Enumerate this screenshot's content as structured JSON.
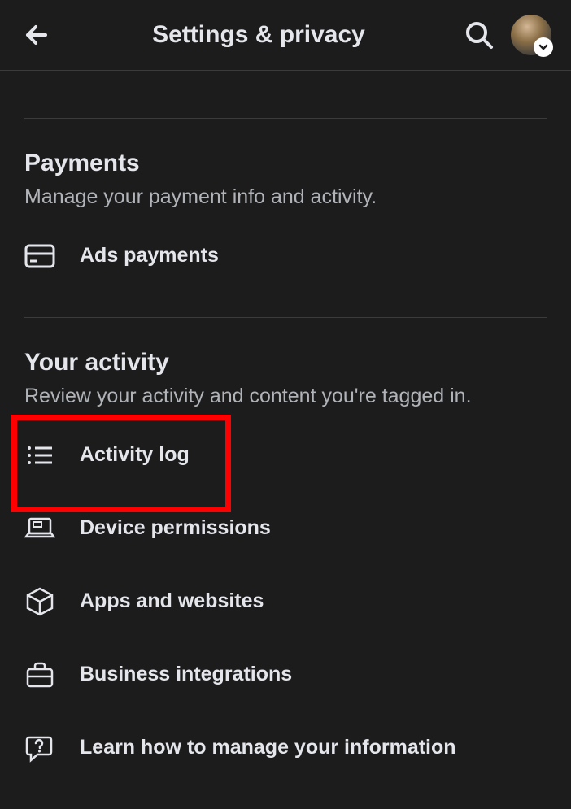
{
  "header": {
    "title": "Settings & privacy"
  },
  "sections": {
    "payments": {
      "title": "Payments",
      "subtitle": "Manage your payment info and activity.",
      "items": [
        {
          "label": "Ads payments"
        }
      ]
    },
    "activity": {
      "title": "Your activity",
      "subtitle": "Review your activity and content you're tagged in.",
      "items": [
        {
          "label": "Activity log"
        },
        {
          "label": "Device permissions"
        },
        {
          "label": "Apps and websites"
        },
        {
          "label": "Business integrations"
        },
        {
          "label": "Learn how to manage your information"
        }
      ]
    }
  },
  "highlight": {
    "target": "activity-log"
  }
}
